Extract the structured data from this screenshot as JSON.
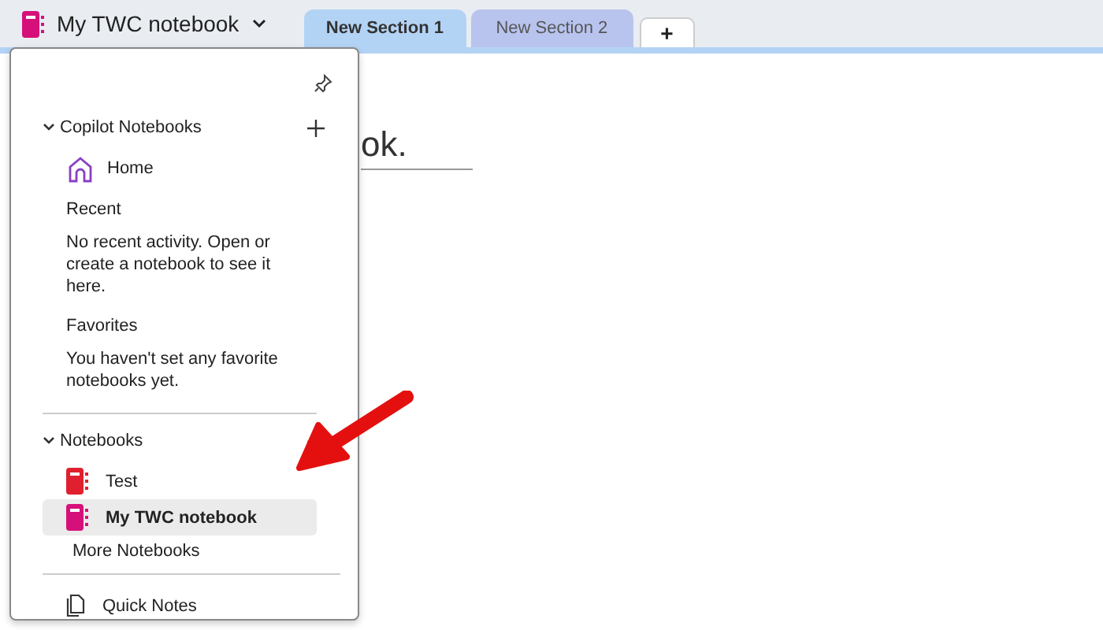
{
  "notebook": {
    "name": "My TWC notebook",
    "color": "#d6107a"
  },
  "tabs": [
    {
      "label": "New Section 1",
      "selected": true
    },
    {
      "label": "New Section 2",
      "selected": false
    }
  ],
  "add_tab": "+",
  "page": {
    "title": "ok."
  },
  "flyout": {
    "pinned": false,
    "copilot": {
      "label": "Copilot Notebooks",
      "expanded": true,
      "items": [
        {
          "label": "Home"
        }
      ]
    },
    "recent": {
      "label": "Recent",
      "message": "No recent activity. Open or create a notebook to see it here."
    },
    "favorites": {
      "label": "Favorites",
      "message": "You haven't set any favorite notebooks yet."
    },
    "notebooks": {
      "label": "Notebooks",
      "expanded": true,
      "items": [
        {
          "label": "Test",
          "color": "#e0202e",
          "selected": false
        },
        {
          "label": "My TWC notebook",
          "color": "#d6107a",
          "selected": true
        }
      ]
    },
    "more": "More Notebooks",
    "quick_notes": "Quick Notes"
  }
}
